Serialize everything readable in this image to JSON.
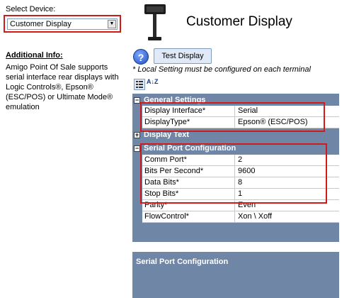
{
  "device_selector": {
    "label": "Select Device:",
    "selected": "Customer Display"
  },
  "info": {
    "title": "Additional Info:",
    "text_lines": [
      "Amigo Point Of Sale supports",
      "serial interface rear displays with",
      "Logic Controls®, Epson®",
      "(ESC/POS) or Ultimate Mode®",
      "emulation"
    ]
  },
  "page_title": "Customer Display",
  "toolbar": {
    "help_icon": "?",
    "test_button": "Test Display",
    "note": "* Local Setting must be configured on each terminal",
    "sort_icon_text": "A↓Z"
  },
  "grid": {
    "categories": [
      {
        "label": "General Settings",
        "toggle": "−"
      },
      {
        "label": "Display Text",
        "toggle": "+"
      },
      {
        "label": "Serial Port Configuration",
        "toggle": "−"
      }
    ],
    "general": [
      {
        "name": "Display Interface*",
        "value": "Serial"
      },
      {
        "name": "DisplayType*",
        "value": "Epson® (ESC/POS)"
      }
    ],
    "serial": [
      {
        "name": "Comm Port*",
        "value": "2"
      },
      {
        "name": "Bits Per Second*",
        "value": "9600"
      },
      {
        "name": "Data Bits*",
        "value": "8"
      },
      {
        "name": "Stop Bits*",
        "value": "1"
      },
      {
        "name": "Parity*",
        "value": "Even"
      },
      {
        "name": "FlowControl*",
        "value": "Xon \\ Xoff"
      }
    ]
  },
  "description_panel": {
    "title": "Serial Port Configuration"
  },
  "colors": {
    "grid_header": "#6f86a6",
    "highlight": "#d11a1a"
  }
}
